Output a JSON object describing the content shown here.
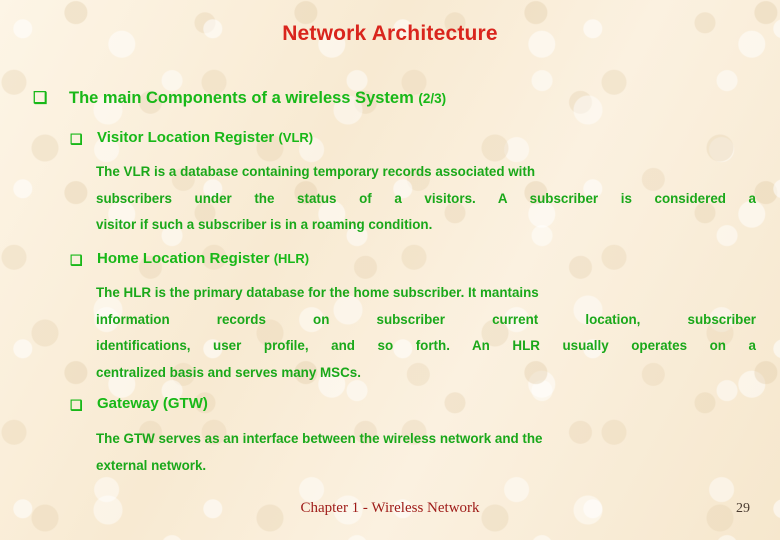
{
  "slide": {
    "title": "Network Architecture",
    "bullet_glyph": "❑",
    "accent_title_color": "#d9251d",
    "heading_green": "#18b818",
    "body_green": "#1aa81a",
    "background_color": "#faeeda"
  },
  "main_bullet": {
    "text": "The main Components of a wireless System ",
    "suffix": "(2/3)"
  },
  "sections": [
    {
      "heading": "Visitor Location Register ",
      "heading_suffix": "(VLR)",
      "lines": [
        "The VLR is a database containing temporary records associated with",
        "subscribers under the status of a visitors. A subscriber is considered a",
        "visitor if such a subscriber is in a roaming condition."
      ]
    },
    {
      "heading": "Home Location Register ",
      "heading_suffix": "(HLR)",
      "lines": [
        "The HLR is the primary database for the home subscriber. It mantains",
        "information records on subscriber current location, subscriber",
        "identifications, user profile, and so forth. An HLR usually operates on a",
        "centralized basis and serves many MSCs."
      ]
    },
    {
      "heading": "Gateway (GTW)",
      "heading_suffix": "",
      "lines": [
        "The GTW serves as an interface between the wireless network and the",
        "external network."
      ]
    }
  ],
  "footer": {
    "chapter_label": "Chapter 1 - Wireless Network",
    "page_number": "29"
  }
}
